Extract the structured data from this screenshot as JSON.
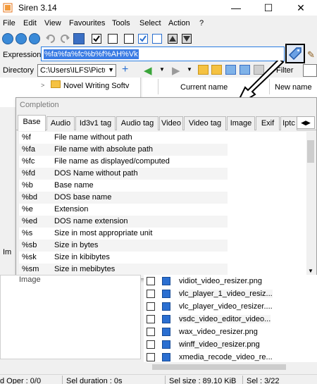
{
  "window": {
    "title": "Siren 3.14",
    "minimize": "—",
    "maximize": "☐",
    "close": "✕"
  },
  "menu": [
    "File",
    "Edit",
    "View",
    "Favourites",
    "Tools",
    "Select",
    "Action",
    "?"
  ],
  "expression": {
    "label": "Expression",
    "value": "%fa%fa%fc%b%f%AH%Vk"
  },
  "directory": {
    "label": "Directory",
    "value": "C:\\Users\\ILFS\\Pictur",
    "filter_label": "Filter"
  },
  "tree": {
    "item": "Novel Writing Softv"
  },
  "filelist": {
    "col_current": "Current name",
    "col_new": "New name"
  },
  "completion": {
    "title": "Completion",
    "tabs": [
      "Base",
      "Audio",
      "Id3v1 tag",
      "Audio tag",
      "Video",
      "Video tag",
      "Image",
      "Exif",
      "Iptc"
    ],
    "active_tab": "Base",
    "items": [
      {
        "code": "%f",
        "desc": "File name without path"
      },
      {
        "code": "%fa",
        "desc": "File name with absolute path"
      },
      {
        "code": "%fc",
        "desc": "File name as displayed/computed"
      },
      {
        "code": "%fd",
        "desc": "DOS Name without path"
      },
      {
        "code": "%b",
        "desc": "Base name"
      },
      {
        "code": "%bd",
        "desc": "DOS base name"
      },
      {
        "code": "%e",
        "desc": "Extension"
      },
      {
        "code": "%ed",
        "desc": "DOS name extension"
      },
      {
        "code": "%s",
        "desc": "Size in most appropriate unit"
      },
      {
        "code": "%sb",
        "desc": "Size in bytes"
      },
      {
        "code": "%sk",
        "desc": "Size in kibibytes"
      },
      {
        "code": "%sm",
        "desc": "Size in mebibytes"
      }
    ]
  },
  "lower": {
    "img_tab": "Im",
    "tree_text": "Image"
  },
  "files": [
    "vidiot_video_resizer.png",
    "vlc_player_1_video_resiz...",
    "vlc_player_video_resizer....",
    "vsdc_video_editor_video...",
    "wax_video_resizer.png",
    "winff_video_resizer.png",
    "xmedia_recode_video_re..."
  ],
  "status": {
    "oper": "d Oper : 0/0",
    "sel_duration": "Sel duration : 0s",
    "sel_size": "Sel size : 89.10 KiB",
    "sel_count": "Sel : 3/22"
  },
  "colors": {
    "accent": "#3b7ce4",
    "icon_blue": "#2b6fd1",
    "folder": "#f5c242"
  }
}
